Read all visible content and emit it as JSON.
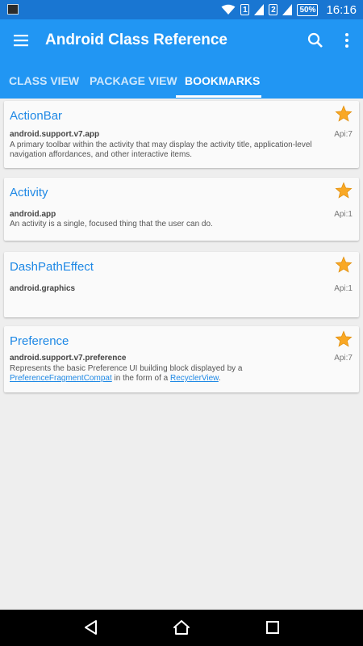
{
  "status_bar": {
    "sim1": "1",
    "sim2": "2",
    "battery": "50%",
    "time": "16:16",
    "icons": [
      "notification-icon",
      "wifi-icon",
      "signal-icon",
      "battery-icon"
    ]
  },
  "app_bar": {
    "title": "Android Class Reference",
    "icons": [
      "menu-icon",
      "search-icon",
      "more-vert-icon"
    ]
  },
  "tabs": [
    {
      "label": "CLASS VIEW"
    },
    {
      "label": "PACKAGE VIEW"
    },
    {
      "label": "BOOKMARKS",
      "active": true
    }
  ],
  "bookmarks": [
    {
      "name": "ActionBar",
      "package": "android.support.v7.app",
      "api": "Api:7",
      "desc_line1": "A primary toolbar within the activity that may display the activity title, application-level",
      "desc_line2": "navigation affordances, and other interactive items."
    },
    {
      "name": "Activity",
      "package": "android.app",
      "api": "Api:1",
      "desc_line1": "An activity is a single, focused thing that the user can do."
    },
    {
      "name": "DashPathEffect",
      "package": "android.graphics",
      "api": "Api:1"
    },
    {
      "name": "Preference",
      "package": "android.support.v7.preference",
      "api": "Api:7",
      "desc_line1": "Represents the basic Preference UI building block displayed by a",
      "link1": "PreferenceFragmentCompat",
      "desc_mid": " in the form of a ",
      "link2": "RecyclerView",
      "desc_end": "."
    }
  ],
  "colors": {
    "primary": "#2196f3",
    "primary_dark": "#1976d2",
    "accent_link": "#1e88e5",
    "star": "#f9a825"
  },
  "nav_bar": {
    "icons": [
      "back-icon",
      "home-icon",
      "recents-icon"
    ]
  }
}
